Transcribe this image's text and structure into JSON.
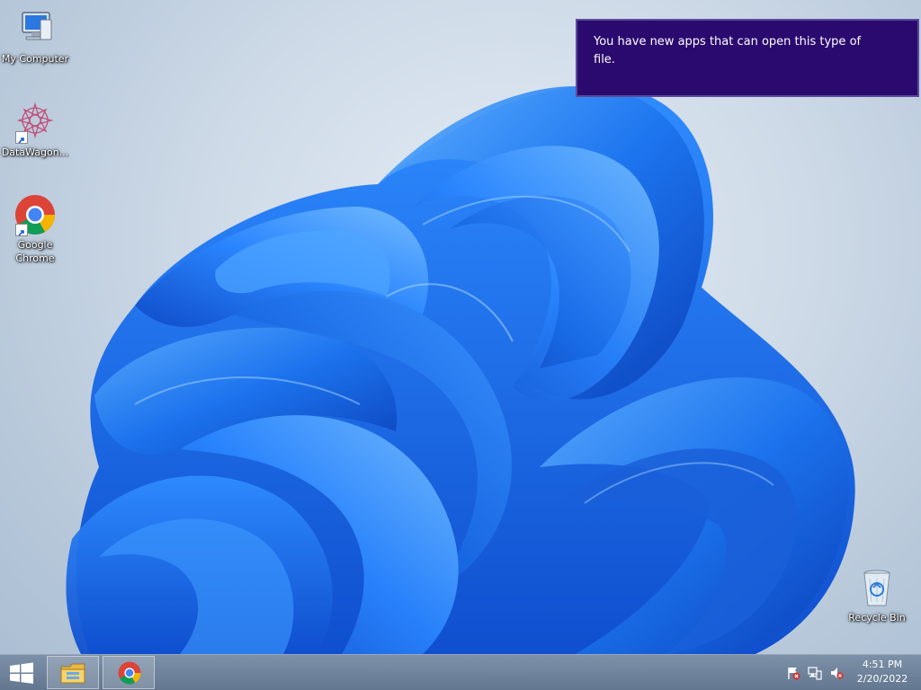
{
  "desktop": {
    "icons": [
      {
        "label": "My Computer",
        "icon": "computer-icon"
      },
      {
        "label": "DataWagon...",
        "icon": "datawagon-icon"
      },
      {
        "label": "Google Chrome",
        "icon": "chrome-icon"
      },
      {
        "label": "Recycle Bin",
        "icon": "recycle-bin-icon"
      }
    ]
  },
  "notification": {
    "message": "You have new apps that can open this type of file."
  },
  "taskbar": {
    "start_icon": "windows-logo-icon",
    "pinned": [
      {
        "name": "File Explorer",
        "icon": "file-explorer-icon"
      },
      {
        "name": "Google Chrome",
        "icon": "chrome-icon"
      }
    ],
    "tray": [
      {
        "icon": "action-center-flag-icon"
      },
      {
        "icon": "network-icon"
      },
      {
        "icon": "volume-muted-icon"
      }
    ],
    "clock": {
      "time": "4:51 PM",
      "date": "2/20/2022"
    }
  },
  "colors": {
    "toast_background": "#2b0a6f",
    "wallpaper_blue": "#1a6ee8",
    "desktop_background": "#c9d7e6"
  }
}
